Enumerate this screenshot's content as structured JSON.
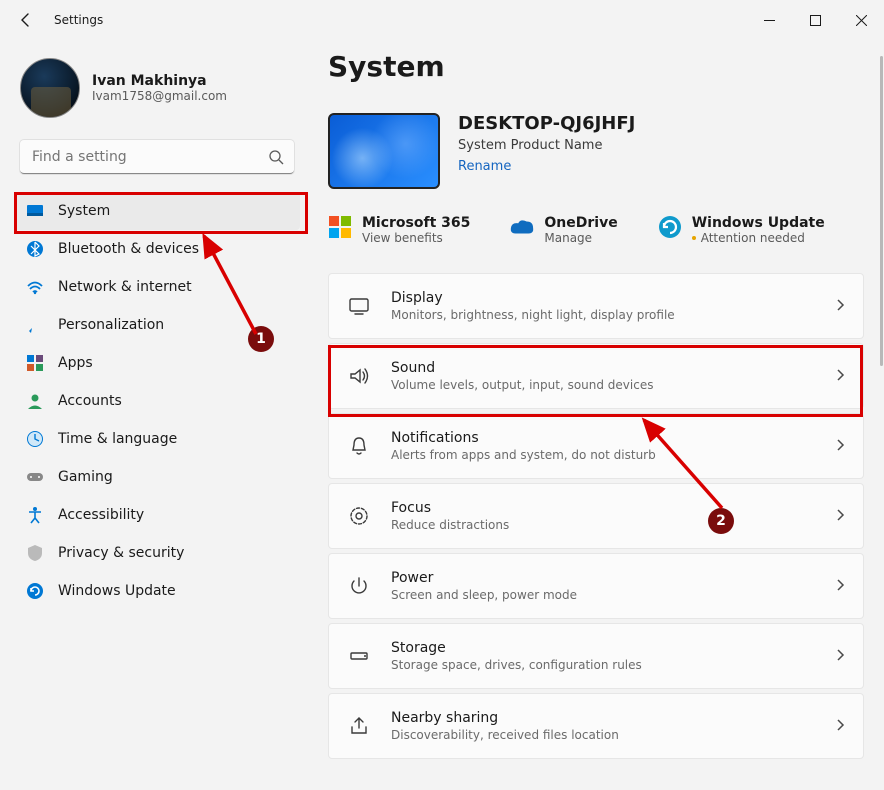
{
  "window": {
    "title": "Settings"
  },
  "profile": {
    "name": "Ivan Makhinya",
    "email": "Ivam1758@gmail.com"
  },
  "search": {
    "placeholder": "Find a setting"
  },
  "sidebar": {
    "items": [
      {
        "icon": "system-icon",
        "label": "System",
        "active": true
      },
      {
        "icon": "bluetooth-icon",
        "label": "Bluetooth & devices"
      },
      {
        "icon": "wifi-icon",
        "label": "Network & internet"
      },
      {
        "icon": "brush-icon",
        "label": "Personalization"
      },
      {
        "icon": "apps-icon",
        "label": "Apps"
      },
      {
        "icon": "account-icon",
        "label": "Accounts"
      },
      {
        "icon": "time-icon",
        "label": "Time & language"
      },
      {
        "icon": "gaming-icon",
        "label": "Gaming"
      },
      {
        "icon": "accessibility-icon",
        "label": "Accessibility"
      },
      {
        "icon": "privacy-icon",
        "label": "Privacy & security"
      },
      {
        "icon": "update-icon",
        "label": "Windows Update"
      }
    ]
  },
  "main": {
    "title": "System",
    "device": {
      "name": "DESKTOP-QJ6JHFJ",
      "product": "System Product Name",
      "rename": "Rename"
    },
    "services": [
      {
        "icon": "m365-icon",
        "title": "Microsoft 365",
        "sub": "View benefits"
      },
      {
        "icon": "onedrive-icon",
        "title": "OneDrive",
        "sub": "Manage"
      },
      {
        "icon": "winupdate-icon",
        "title": "Windows Update",
        "sub": "Attention needed",
        "alert": true
      }
    ],
    "cards": [
      {
        "icon": "display-icon",
        "title": "Display",
        "sub": "Monitors, brightness, night light, display profile"
      },
      {
        "icon": "sound-icon",
        "title": "Sound",
        "sub": "Volume levels, output, input, sound devices"
      },
      {
        "icon": "bell-icon",
        "title": "Notifications",
        "sub": "Alerts from apps and system, do not disturb"
      },
      {
        "icon": "focus-icon",
        "title": "Focus",
        "sub": "Reduce distractions"
      },
      {
        "icon": "power-icon",
        "title": "Power",
        "sub": "Screen and sleep, power mode"
      },
      {
        "icon": "storage-icon",
        "title": "Storage",
        "sub": "Storage space, drives, configuration rules"
      },
      {
        "icon": "share-icon",
        "title": "Nearby sharing",
        "sub": "Discoverability, received files location"
      }
    ]
  },
  "annotations": {
    "step1": "1",
    "step2": "2"
  }
}
